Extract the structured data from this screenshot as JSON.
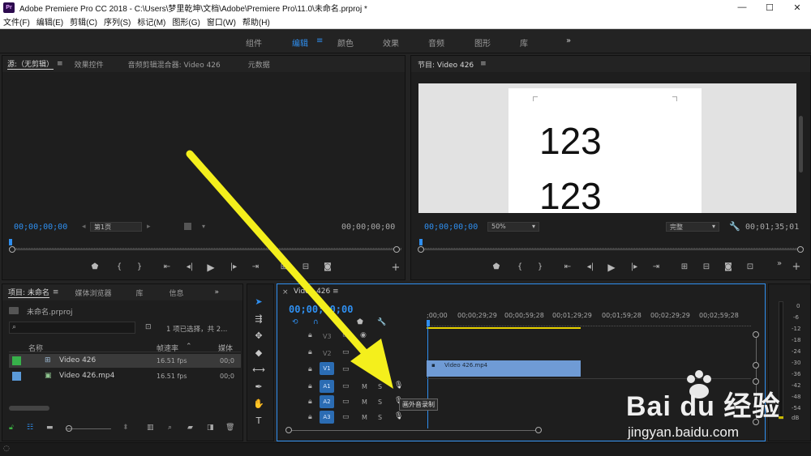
{
  "titlebar": {
    "app_badge": "Pr",
    "title": "Adobe Premiere Pro CC 2018 - C:\\Users\\梦里乾坤\\文档\\Adobe\\Premiere Pro\\11.0\\未命名.prproj *",
    "minimize": "—",
    "maximize": "☐",
    "close": "✕"
  },
  "menubar": {
    "items": [
      "文件(F)",
      "编辑(E)",
      "剪辑(C)",
      "序列(S)",
      "标记(M)",
      "图形(G)",
      "窗口(W)",
      "帮助(H)"
    ]
  },
  "workspaces": {
    "tabs": [
      "组件",
      "编辑",
      "颜色",
      "效果",
      "音频",
      "图形",
      "库"
    ],
    "active_index": 1,
    "menu_icon": "≡",
    "more": "»"
  },
  "source_panel": {
    "tabs": [
      "源:（无剪辑）",
      "效果控件",
      "音频剪辑混合器: Video 426",
      "元数据"
    ],
    "timecode_in": "00;00;00;00",
    "timecode_out": "00;00;00;00",
    "page_select": "第1页"
  },
  "program_panel": {
    "tab": "节目: Video 426",
    "timecode_in": "00;00;00;00",
    "zoom": "50%",
    "quality": "完整",
    "timecode_out": "00;01;35;01",
    "preview_lines": [
      "123",
      "123"
    ]
  },
  "project_panel": {
    "tabs": [
      "项目: 未命名",
      "媒体浏览器",
      "库",
      "信息"
    ],
    "project_file": "未命名.prproj",
    "selection_info": "1 项已选择，共 2...",
    "columns": [
      "名称",
      "帧速率",
      "媒体"
    ],
    "rows": [
      {
        "name": "Video 426",
        "fps": "16.51 fps",
        "media": "00;0",
        "color": "#37b04a"
      },
      {
        "name": "Video 426.mp4",
        "fps": "16.51 fps",
        "media": "00;0",
        "color": "#5b9ad8"
      }
    ]
  },
  "timeline": {
    "tab": "Video 426",
    "timecode": "00;00;00;00",
    "ruler": [
      ";00;00",
      "00;00;29;29",
      "00;00;59;28",
      "00;01;29;29",
      "00;01;59;28",
      "00;02;29;29",
      "00;02;59;28"
    ],
    "video_tracks": [
      "V3",
      "V2",
      "V1"
    ],
    "audio_tracks": [
      "A1",
      "A2",
      "A3"
    ],
    "clip_label": "Video 426.mp4",
    "tooltip": "画外音录制",
    "m_label": "M",
    "s_label": "S"
  },
  "meter": {
    "labels": [
      "0",
      "-6",
      "-12",
      "-18",
      "-24",
      "-30",
      "-36",
      "-42",
      "-48",
      "-54",
      "dB"
    ]
  },
  "watermark": {
    "brand": "Bai du 经验",
    "url": "jingyan.baidu.com"
  },
  "colors": {
    "accent": "#2f8ff0",
    "clip": "#6f9bd5",
    "arrow": "#f4ef1c"
  }
}
